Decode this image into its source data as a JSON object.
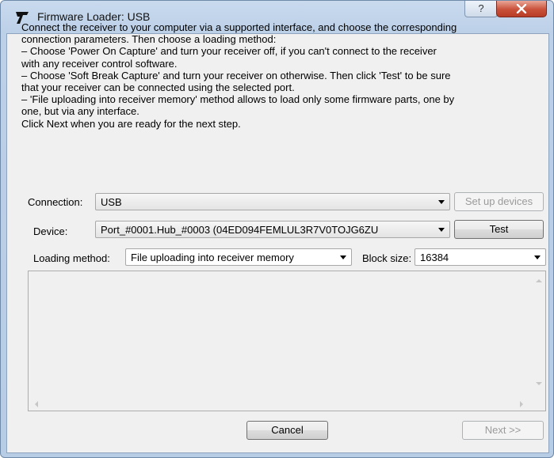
{
  "window": {
    "title": "Firmware Loader: USB",
    "help_glyph": "?",
    "close_icon": "close-icon"
  },
  "instructions": [
    "Connect the receiver to your computer via a supported interface, and choose the corresponding",
    "connection parameters. Then choose a loading method:",
    "  – Choose 'Power On Capture' and turn your receiver off, if you can't connect to the receiver",
    "with any receiver control software.",
    "  – Choose 'Soft Break Capture' and turn your receiver on otherwise. Then click 'Test' to be sure",
    "that your receiver can be connected using the selected port.",
    "  – 'File uploading into receiver memory' method allows to load only some firmware parts, one by",
    "one, but via any interface.",
    "Click Next when you are ready for the next step."
  ],
  "connection": {
    "label": "Connection:",
    "value": "USB",
    "setup_button": "Set up devices"
  },
  "device": {
    "label": "Device:",
    "value": "Port_#0001.Hub_#0003 (04ED094FEMLUL3R7V0TOJG6ZU",
    "test_button": "Test"
  },
  "loading": {
    "label": "Loading method:",
    "value": "File uploading into receiver memory"
  },
  "block": {
    "label": "Block size:",
    "value": "16384"
  },
  "buttons": {
    "cancel": "Cancel",
    "next": "Next >>"
  }
}
